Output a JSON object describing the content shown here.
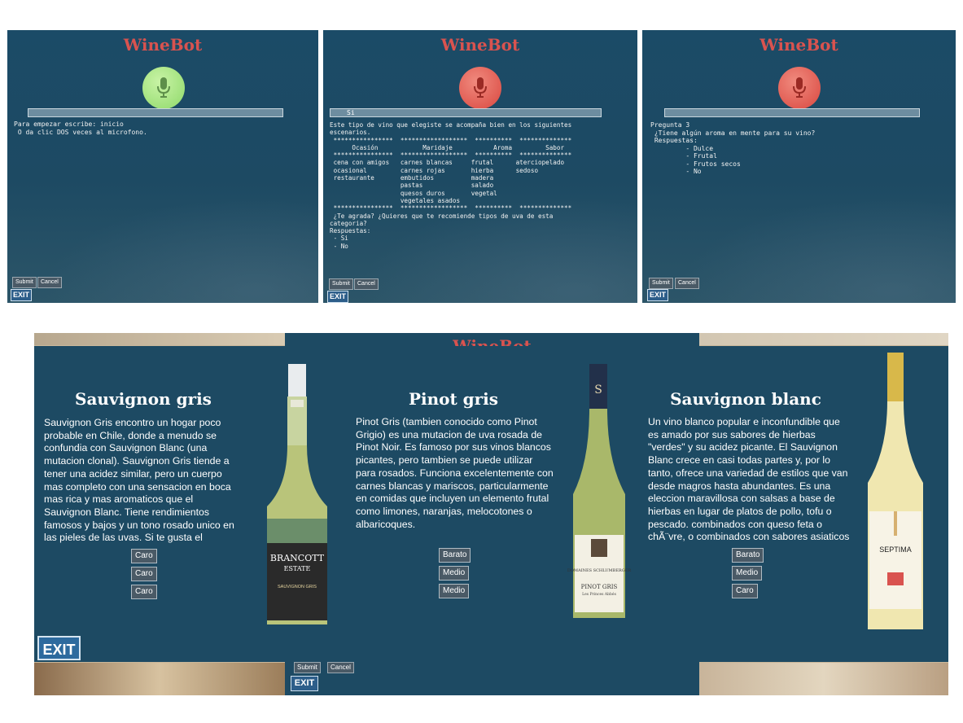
{
  "app_title": "WineBot",
  "panels": [
    {
      "input_value": "",
      "output_text": "Para empezar escribe: inicio\n O da clic DOS veces al microfono.",
      "submit_label": "Submit",
      "cancel_label": "Cancel",
      "exit_label": "EXIT",
      "mic_color": "#8fd96a"
    },
    {
      "input_value": "Si",
      "output_text": "Este tipo de vino que elegiste se acompaña bien en los siguientes\nescenarios.\n ****************  ******************  **********  **************\n      Ocasión            Maridaje           Aroma         Sabor\n ****************  ******************  **********  **************\n cena con amigos   carnes blancas     frutal      aterciopelado\n ocasional         carnes rojas       hierba      sedoso\n restaurante       embutidos          madera\n                   pastas             salado\n                   quesos duros       vegetal\n                   vegetales asados\n ****************  ******************  **********  **************\n ¿Te agrada? ¿Quieres que te recomiende tipos de uva de esta\ncategoria?\nRespuestas:\n - Si\n - No",
      "submit_label": "Submit",
      "cancel_label": "Cancel",
      "exit_label": "EXIT",
      "mic_color": "#d9473f"
    },
    {
      "input_value": "",
      "output_text": "Pregunta 3\n ¿Tiene algún aroma en mente para su vino?\n Respuestas:\n         - Dulce\n         - Frutal\n         - Frutos secos\n         - No",
      "submit_label": "Submit",
      "cancel_label": "Cancel",
      "exit_label": "EXIT",
      "mic_color": "#d9473f"
    }
  ],
  "wines": [
    {
      "name": "Sauvignon gris",
      "description": "Sauvignon Gris encontro un hogar poco probable en Chile, donde a menudo se confundia con Sauvignon Blanc (una mutacion clonal). Sauvignon Gris tiende a tener una acidez similar, pero un cuerpo mas completo con una sensacion en boca mas rica y mas aromaticos que el Sauvignon Blanc. Tiene rendimientos famosos y bajos y un tono rosado unico en las pieles de las uvas. Si te gusta el Sauvignon Blanc, entonces esta es",
      "options": [
        "Caro",
        "Caro",
        "Caro"
      ],
      "bottle_brand": "BRANCOTT",
      "bottle_sub": "ESTATE",
      "bottle_variety": "SAUVIGNON GRIS"
    },
    {
      "name": "Pinot gris",
      "description": "Pinot Gris (tambien conocido como Pinot Grigio) es una mutacion de uva rosada de Pinot Noir. Es famoso por sus vinos blancos picantes, pero tambien se puede utilizar para rosados. Funciona excelentemente con carnes blancas y mariscos, particularmente en comidas que incluyen un elemento frutal como limones, naranjas, melocotones o albaricoques.",
      "options": [
        "Barato",
        "Medio",
        "Medio"
      ],
      "bottle_brand": "DOMAINES SCHLUMBERGER",
      "bottle_sub": "PINOT GRIS",
      "bottle_variety": "Les Princes Abbés",
      "bottle_top": "S"
    },
    {
      "name": "Sauvignon blanc",
      "description": "Un vino blanco popular e inconfundible que es amado por sus sabores de hierbas \"verdes\" y su acidez picante. El Sauvignon Blanc crece en casi todas partes y, por lo tanto, ofrece una variedad de estilos que van desde magros hasta abundantes. Es una eleccion maravillosa con salsas a base de hierbas en lugar de platos de pollo, tofu o pescado. combinados con queso feta o chÃ¨vre, o combinados con sabores asiaticos",
      "options": [
        "Barato",
        "Medio",
        "Caro"
      ],
      "bottle_brand": "SEPTIMA"
    }
  ],
  "bottom": {
    "exit_label": "EXIT",
    "submit_label": "Submit",
    "cancel_label": "Cancel"
  },
  "colors": {
    "panel_bg": "#1d4a63",
    "title_red": "#d9534f",
    "button_bg": "#4a5a66"
  }
}
